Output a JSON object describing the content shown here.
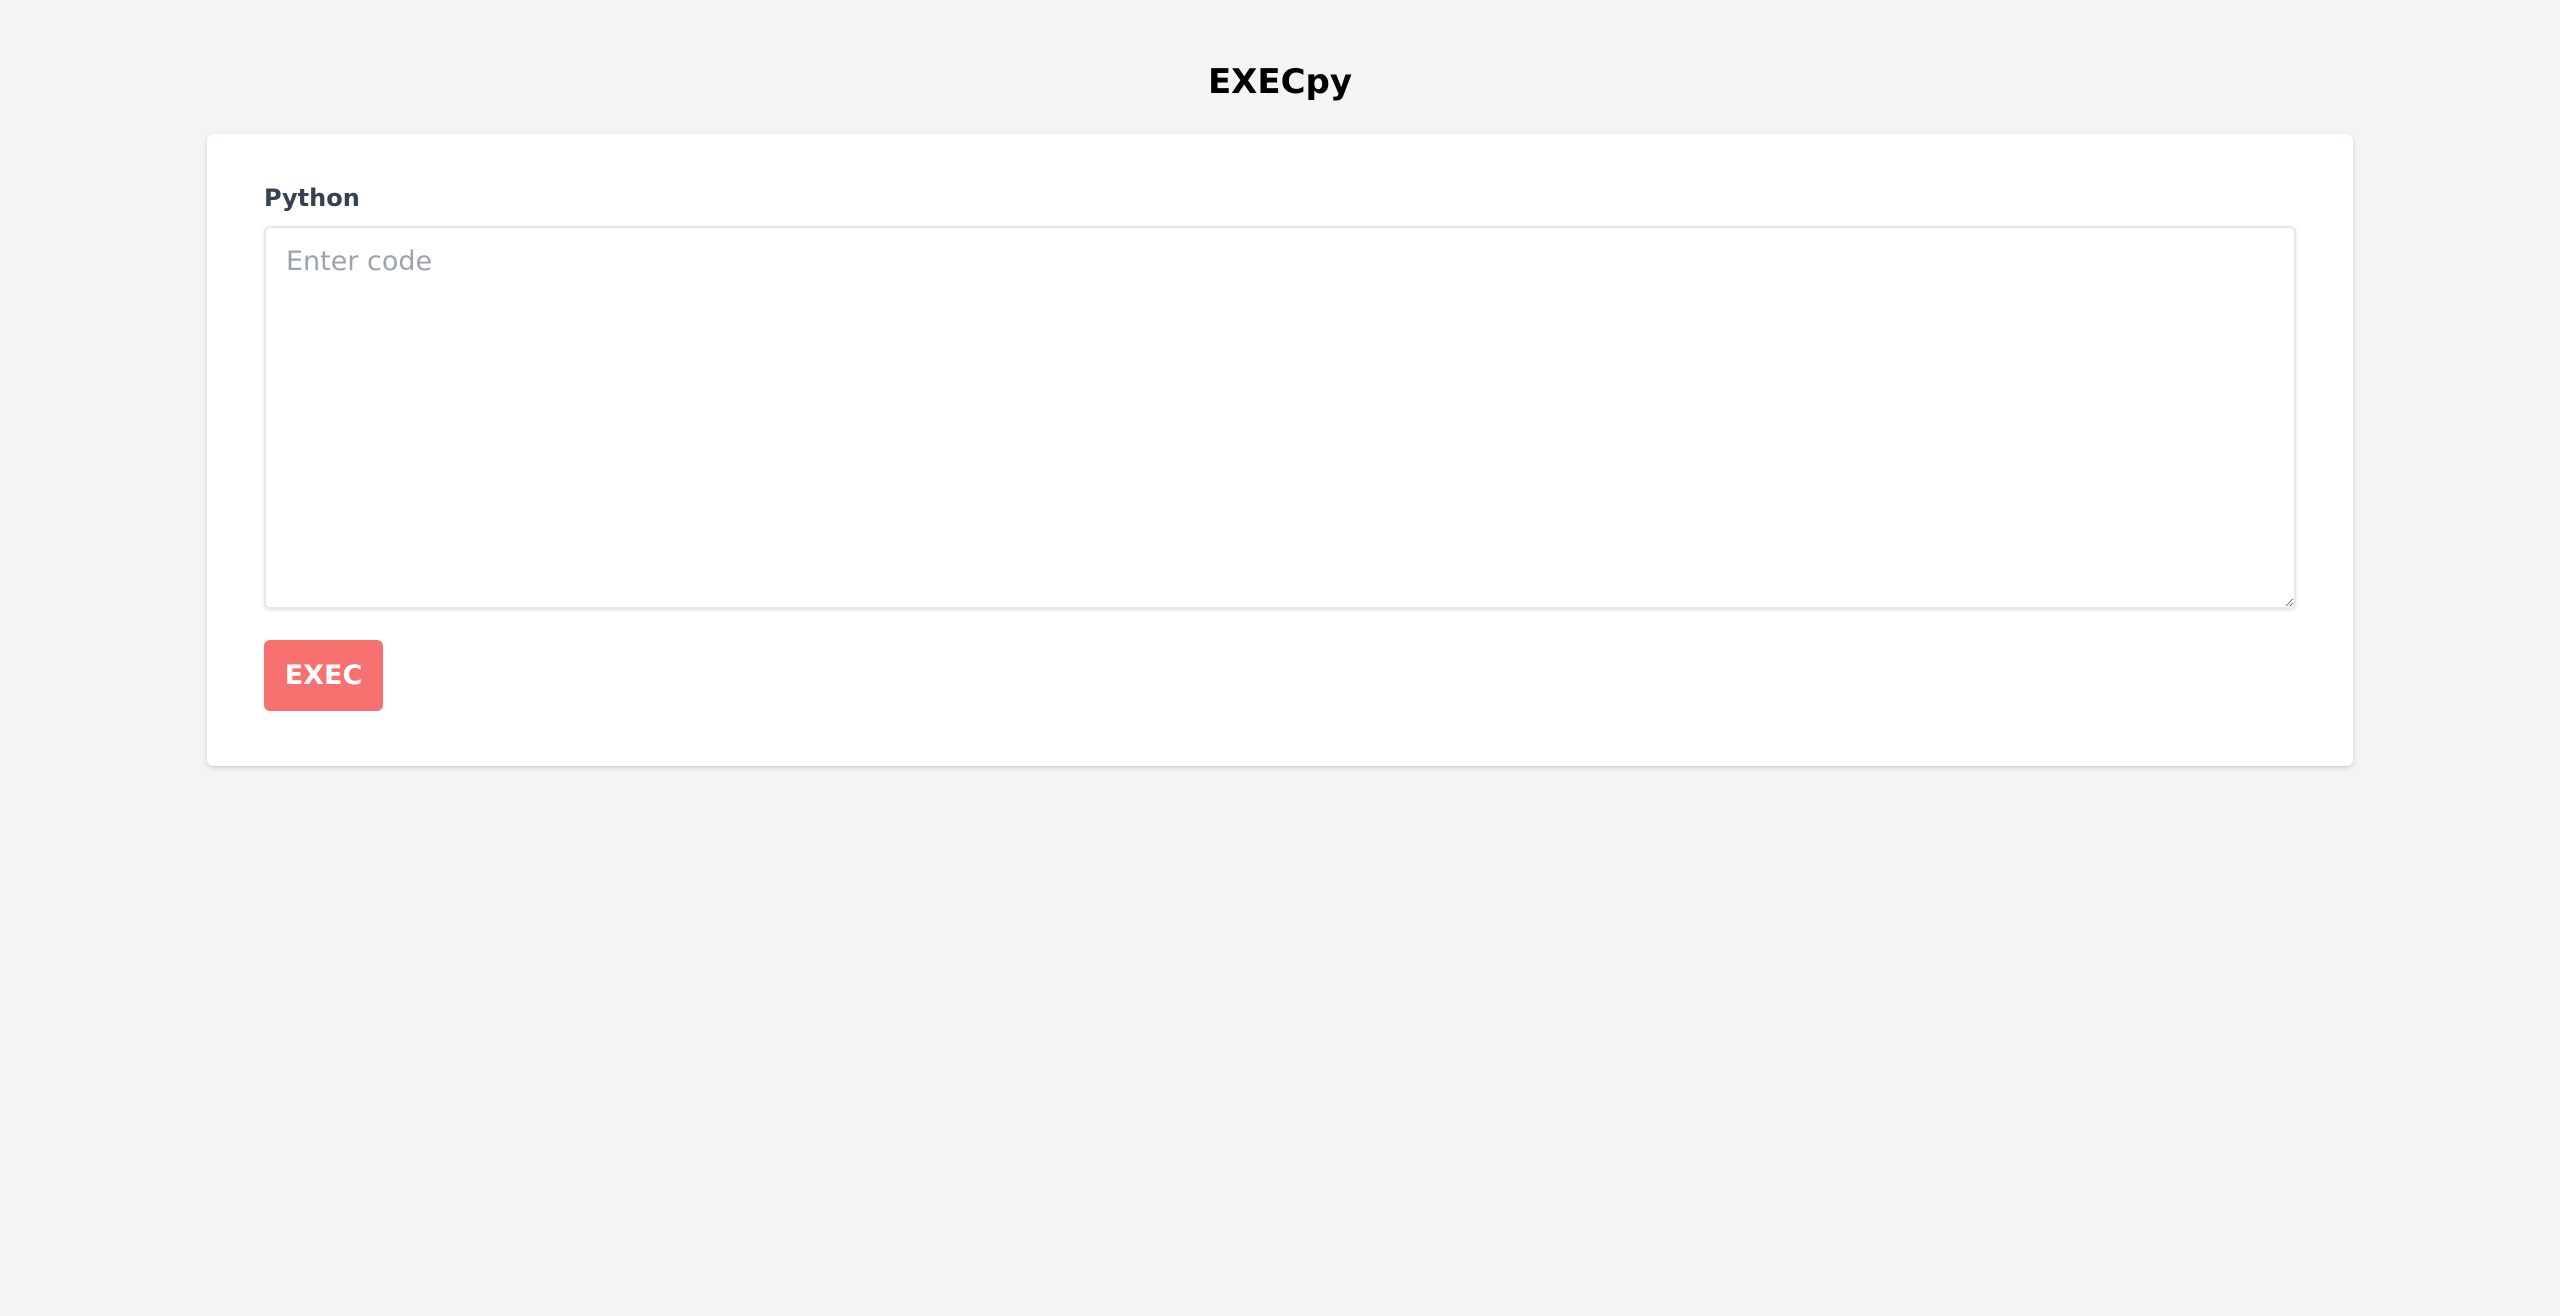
{
  "app": {
    "title": "EXECpy"
  },
  "form": {
    "label": "Python",
    "code_placeholder": "Enter code",
    "code_value": "",
    "submit_label": "EXEC"
  },
  "colors": {
    "page_background": "#f3f4f6",
    "card_background": "#ffffff",
    "button_background": "#f87171",
    "button_text": "#ffffff",
    "label_text": "#374151",
    "placeholder_text": "#9ca3af"
  }
}
